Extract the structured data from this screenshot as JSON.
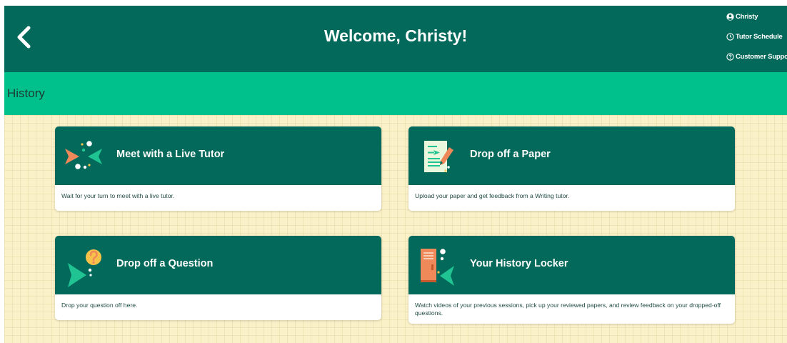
{
  "header": {
    "title": "Welcome, Christy!",
    "background": "#03695a"
  },
  "user_menu": {
    "items": [
      {
        "label": "Christy",
        "icon": "user-circle-icon"
      },
      {
        "label": "Tutor Schedule",
        "icon": "clock-icon"
      },
      {
        "label": "Customer Suppo",
        "icon": "help-circle-icon"
      }
    ]
  },
  "history_bar": {
    "label": "History",
    "background": "#00c08b"
  },
  "cards": [
    {
      "title": "Meet with a Live Tutor",
      "description": "Wait for your turn to meet with a live tutor.",
      "icon": "live-tutor-icon"
    },
    {
      "title": "Drop off a Paper",
      "description": "Upload your paper and get feedback from a Writing tutor.",
      "icon": "paper-icon"
    },
    {
      "title": "Drop off a Question",
      "description": "Drop your question off here.",
      "icon": "question-icon"
    },
    {
      "title": "Your History Locker",
      "description": "Watch videos of your previous sessions, pick up your reviewed papers, and review feedback on your dropped-off questions.",
      "icon": "locker-icon"
    }
  ],
  "colors": {
    "accent_orange": "#f0895a",
    "accent_green": "#1fc492",
    "accent_yellow": "#f7c24a",
    "content_background": "#fbf1c8"
  }
}
